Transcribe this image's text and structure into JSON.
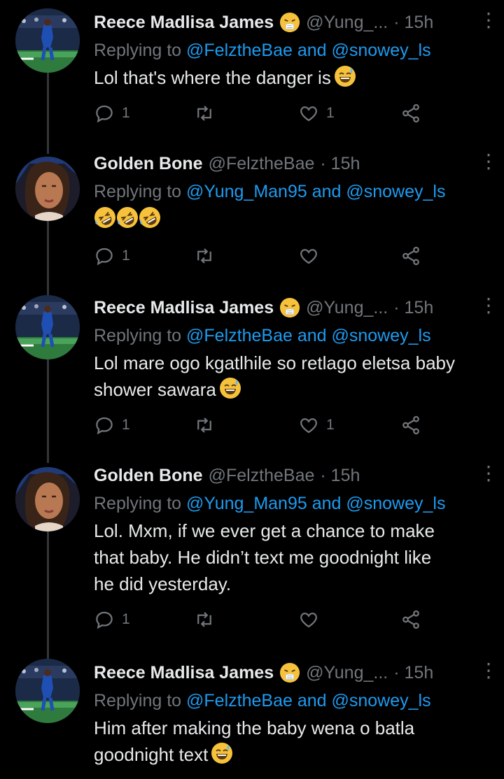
{
  "tweets": [
    {
      "name": "Reece Madlisa James",
      "handle": "@Yung_...",
      "time": "· 15h",
      "replying_prefix": "Replying to",
      "replying_to": "@FelztheBae and @snowey_ls",
      "text": "Lol that's where the danger is",
      "text_emoji": "sweat-smile-emoji",
      "reply_count": "1",
      "retweet_count": "",
      "like_count": "1",
      "avatar": "player-avatar"
    },
    {
      "name": "Golden Bone",
      "handle": "@FelztheBae",
      "time": "· 15h",
      "replying_prefix": "Replying to",
      "replying_to": "@Yung_Man95 and @snowey_ls",
      "text": "",
      "text_emoji": "rofl-emoji-x3",
      "reply_count": "1",
      "retweet_count": "",
      "like_count": "",
      "avatar": "woman-avatar"
    },
    {
      "name": "Reece Madlisa James",
      "handle": "@Yung_...",
      "time": "· 15h",
      "replying_prefix": "Replying to",
      "replying_to": "@FelztheBae and @snowey_ls",
      "text_line1": "Lol mare ogo kgatlhile so retlago eletsa baby",
      "text_line2": "shower sawara",
      "text_emoji": "sweat-smile-emoji",
      "reply_count": "1",
      "retweet_count": "",
      "like_count": "1",
      "avatar": "player-avatar"
    },
    {
      "name": "Golden Bone",
      "handle": "@FelztheBae",
      "time": "· 15h",
      "replying_prefix": "Replying to",
      "replying_to": "@Yung_Man95 and @snowey_ls",
      "text_line1": "Lol. Mxm, if we ever get a chance to make",
      "text_line2": "that baby. He didn’t text me goodnight like",
      "text_line3": "he did yesterday.",
      "reply_count": "1",
      "retweet_count": "",
      "like_count": "",
      "avatar": "woman-avatar"
    },
    {
      "name": "Reece Madlisa James",
      "handle": "@Yung_...",
      "time": "· 15h",
      "replying_prefix": "Replying to",
      "replying_to": "@FelztheBae and @snowey_ls",
      "text_line1": "Him after making the baby wena o batla",
      "text_line2": "goodnight text",
      "text_emoji": "sweat-smile-emoji",
      "avatar": "player-avatar"
    }
  ],
  "name_emoji": "sneezing-face-emoji",
  "icons": {
    "reply": "reply-icon",
    "retweet": "retweet-icon",
    "like": "like-icon",
    "share": "share-icon",
    "more": "more-icon"
  },
  "colors": {
    "background": "#000000",
    "text": "#e7e9ea",
    "muted": "#71767b",
    "link": "#1d9bf0"
  }
}
